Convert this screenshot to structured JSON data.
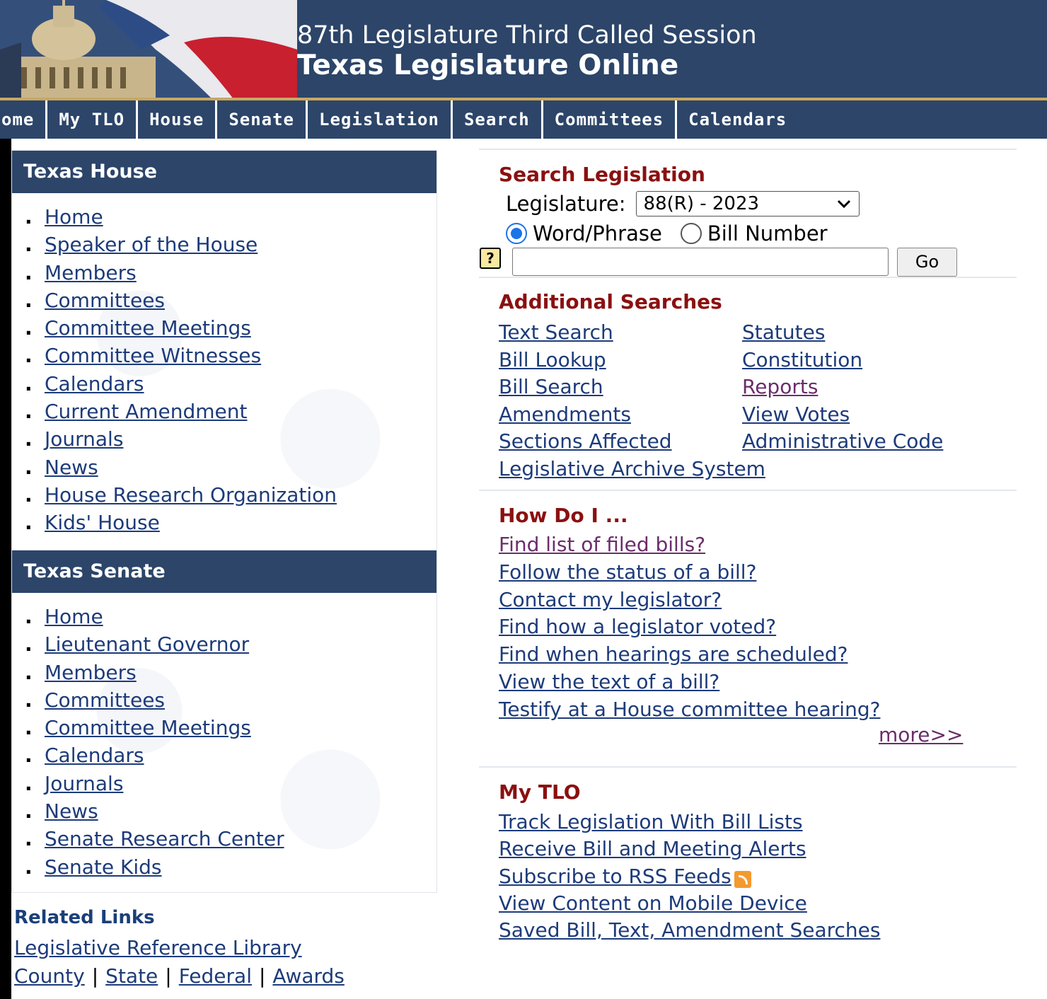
{
  "header": {
    "subtitle": "87th Legislature Third Called Session",
    "title": "Texas Legislature Online"
  },
  "nav": [
    "ome",
    "My TLO",
    "House",
    "Senate",
    "Legislation",
    "Search",
    "Committees",
    "Calendars"
  ],
  "house": {
    "title": "Texas House",
    "items": [
      "Home",
      "Speaker of the House",
      "Members",
      "Committees",
      "Committee Meetings",
      "Committee Witnesses",
      "Calendars",
      "Current Amendment",
      "Journals",
      "News",
      "House Research Organization",
      "Kids' House"
    ]
  },
  "senate": {
    "title": "Texas Senate",
    "items": [
      "Home",
      "Lieutenant Governor",
      "Members",
      "Committees",
      "Committee Meetings",
      "Calendars",
      "Journals",
      "News",
      "Senate Research Center",
      "Senate Kids"
    ]
  },
  "related": {
    "title": "Related Links",
    "library": "Legislative Reference Library",
    "links": [
      "County",
      "State",
      "Federal",
      "Awards"
    ],
    "sep": "|"
  },
  "search": {
    "title": "Search Legislation",
    "legislature_label": "Legislature:",
    "legislature_value": "88(R) - 2023",
    "option_word": "Word/Phrase",
    "option_bill": "Bill Number",
    "go": "Go",
    "query": ""
  },
  "additional": {
    "title": "Additional Searches",
    "left": [
      "Text Search",
      "Bill Lookup",
      "Bill Search",
      "Amendments",
      "Sections Affected"
    ],
    "right": [
      "Statutes",
      "Constitution",
      "Reports",
      "View Votes",
      "Administrative Code"
    ],
    "archive": "Legislative Archive System"
  },
  "howdoi": {
    "title": "How Do I ...",
    "items": [
      "Find list of filed bills?",
      "Follow the status of a bill?",
      "Contact my legislator?",
      "Find how a legislator voted?",
      "Find when hearings are scheduled?",
      "View the text of a bill?",
      "Testify at a House committee hearing?"
    ],
    "more": "more>>"
  },
  "mytlo": {
    "title": "My TLO",
    "items": [
      "Track Legislation With Bill Lists",
      "Receive Bill and Meeting Alerts",
      "Subscribe to RSS Feeds",
      "View Content on Mobile Device",
      "Saved Bill, Text, Amendment Searches"
    ]
  }
}
